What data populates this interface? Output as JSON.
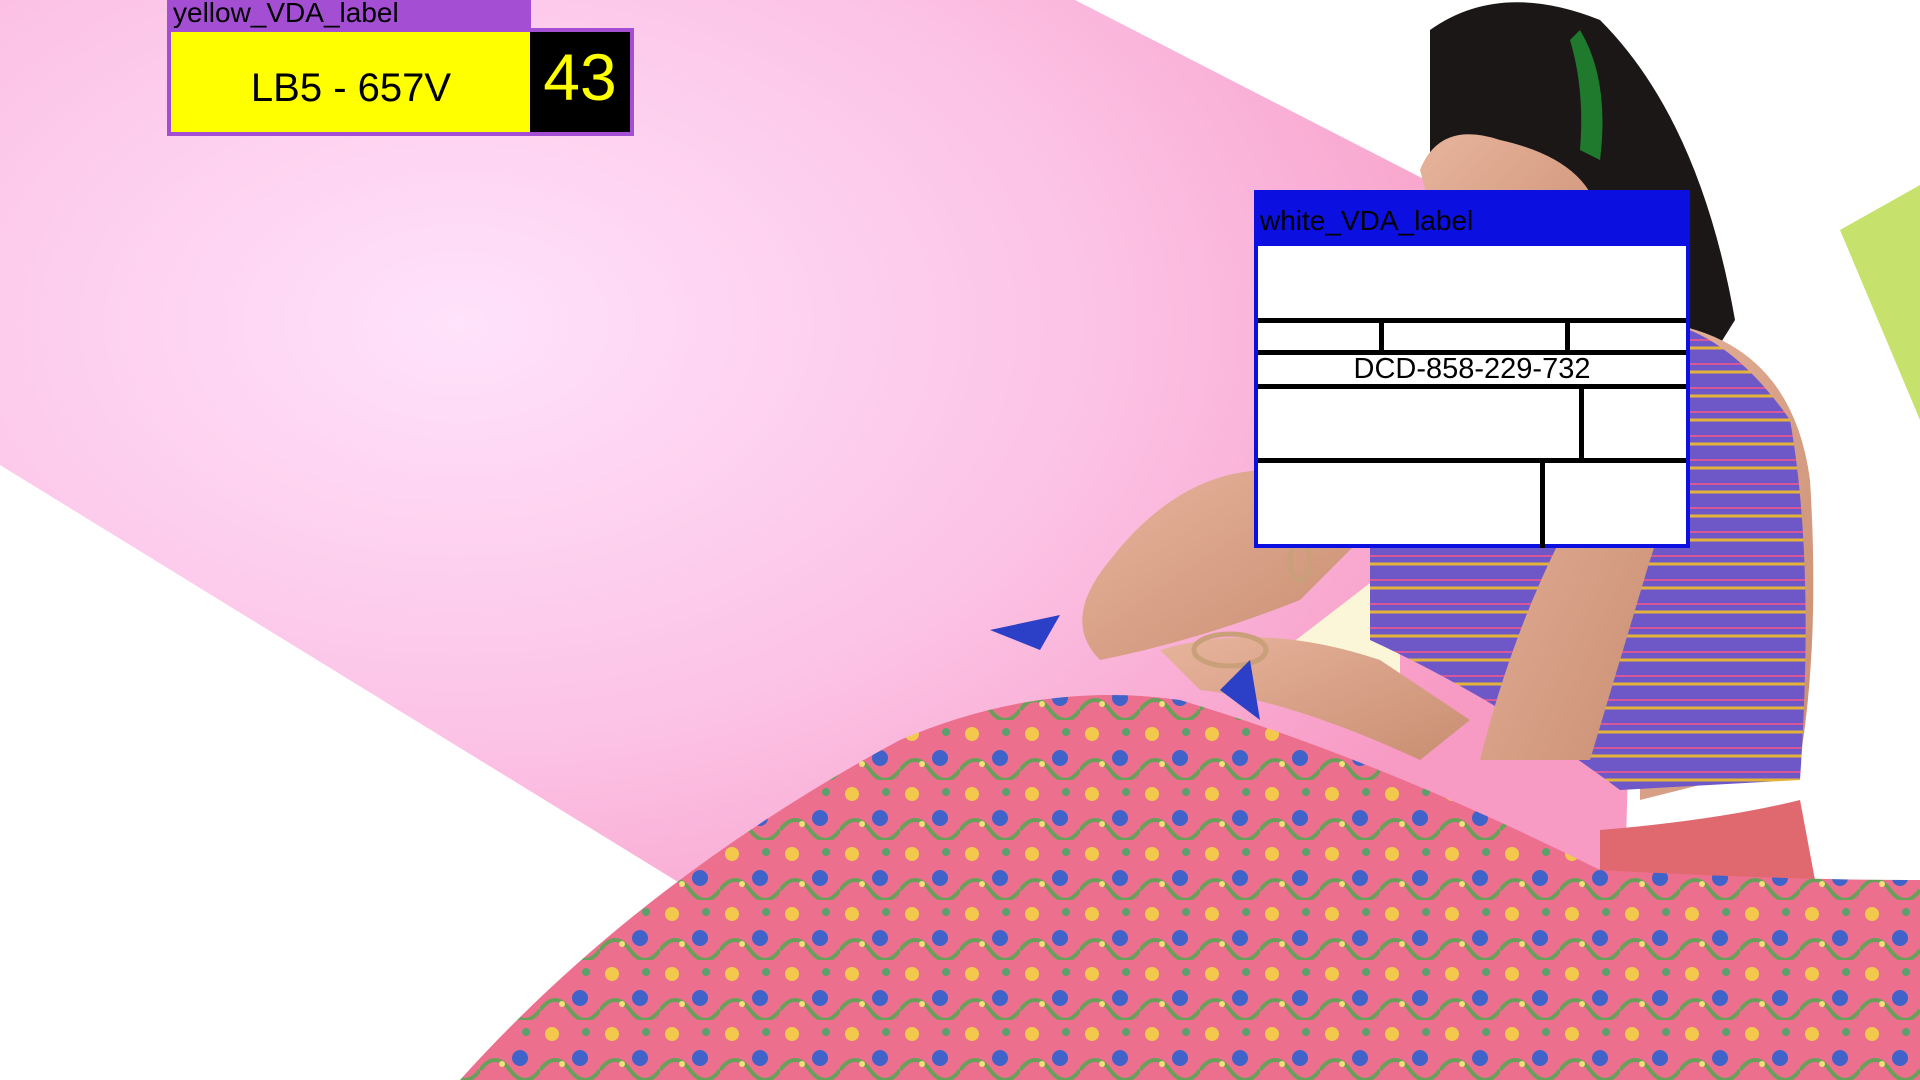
{
  "colors": {
    "pink_band": "#fbb7dc",
    "pink_glow": "#ffe1f8",
    "background": "#ffffff",
    "skirt": "#e86b8a",
    "blouse": "#7e5bc4",
    "yellow_label": "#ffff00",
    "yellow_label_frame": "#a44fd3",
    "white_label_frame": "#0b10e0"
  },
  "yellow_vda_label": {
    "tag": "yellow_VDA_label",
    "code": "LB5 - 657V",
    "number": "43"
  },
  "white_vda_label": {
    "tag": "white_VDA_label",
    "code": "DCD-858-229-732"
  }
}
